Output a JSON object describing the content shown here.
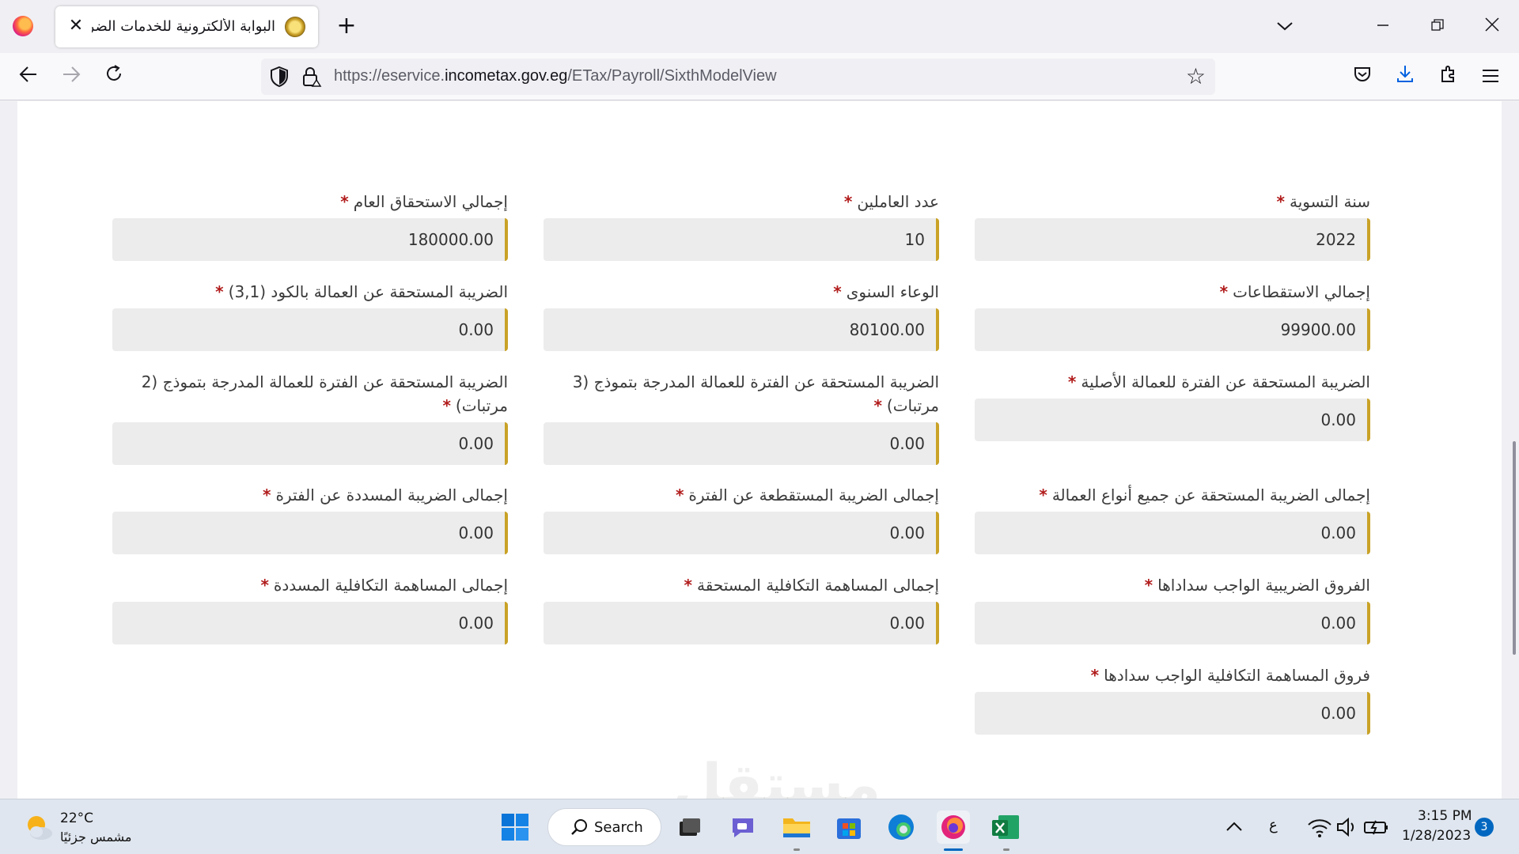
{
  "browser": {
    "tab_title": "البوابة الألكترونية للخدمات الضريبية",
    "new_tab_label": "+",
    "close_tab_label": "✕",
    "url_prefix": "https://eservice.",
    "url_domain": "incometax.gov.eg",
    "url_path": "/ETax/Payroll/SixthModelView"
  },
  "form": {
    "required_mark": "*",
    "fields": [
      {
        "label": "سنة التسوية",
        "value": "2022"
      },
      {
        "label": "عدد العاملين",
        "value": "10"
      },
      {
        "label": "إجمالي الاستحقاق العام",
        "value": "180000.00"
      },
      {
        "label": "إجمالي الاستقطاعات",
        "value": "99900.00"
      },
      {
        "label": "الوعاء السنوى",
        "value": "80100.00"
      },
      {
        "label": "الضريبة المستحقة عن العمالة بالكود (3,1)",
        "value": "0.00"
      },
      {
        "label": "الضريبة المستحقة عن الفترة للعمالة الأصلية",
        "value": "0.00"
      },
      {
        "label": "الضريبة المستحقة عن الفترة للعمالة المدرجة بتموذج (3 مرتبات)",
        "value": "0.00"
      },
      {
        "label": "الضريبة المستحقة عن الفترة للعمالة المدرجة بتموذج (2 مرتبات)",
        "value": "0.00"
      },
      {
        "label": "إجمالى الضريبة المستحقة عن جميع أنواع العمالة",
        "value": "0.00"
      },
      {
        "label": "إجمالى الضريبة المستقطعة عن الفترة",
        "value": "0.00"
      },
      {
        "label": "إجمالى الضريبة المسددة عن الفترة",
        "value": "0.00"
      },
      {
        "label": "الفروق الضريبية الواجب سداداها",
        "value": "0.00"
      },
      {
        "label": "إجمالى المساهمة التكافلية المستحقة",
        "value": "0.00"
      },
      {
        "label": "إجمالى المساهمة التكافلية المسددة",
        "value": "0.00"
      },
      {
        "label": "فروق المساهمة التكافلية الواجب سدادها",
        "value": "0.00"
      }
    ]
  },
  "watermark": "مستقل",
  "taskbar": {
    "weather_temp": "22°C",
    "weather_desc": "مشمس جزئيًا",
    "search_label": "Search",
    "lang": "ع",
    "time": "3:15 PM",
    "date": "1/28/2023",
    "notification_count": "3"
  },
  "colors": {
    "input_accent": "#c9a227",
    "required": "#b11b1b",
    "input_bg": "#ececec"
  }
}
